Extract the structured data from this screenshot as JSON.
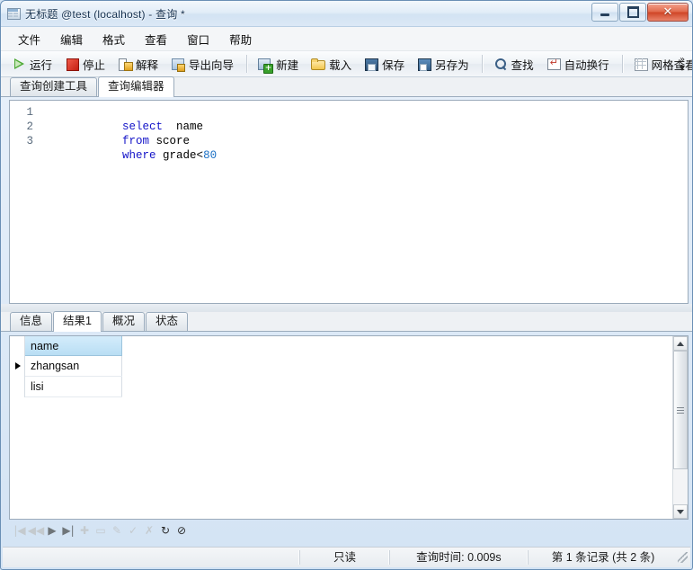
{
  "window": {
    "title": "无标题 @test (localhost) - 查询 *",
    "icon": "query-window-icon",
    "buttons": {
      "minimize": "minimize-icon",
      "maximize": "maximize-icon",
      "close": "✕"
    }
  },
  "menubar": {
    "items": [
      {
        "label": "文件"
      },
      {
        "label": "编辑"
      },
      {
        "label": "格式"
      },
      {
        "label": "查看"
      },
      {
        "label": "窗口"
      },
      {
        "label": "帮助"
      }
    ]
  },
  "toolbar": {
    "groups": [
      {
        "items": [
          {
            "label": "运行",
            "icon": "run-icon"
          },
          {
            "label": "停止",
            "icon": "stop-icon"
          },
          {
            "label": "解释",
            "icon": "explain-icon"
          },
          {
            "label": "导出向导",
            "icon": "export-wizard-icon"
          }
        ]
      },
      {
        "items": [
          {
            "label": "新建",
            "icon": "new-icon"
          },
          {
            "label": "载入",
            "icon": "load-icon"
          },
          {
            "label": "保存",
            "icon": "save-icon"
          },
          {
            "label": "另存为",
            "icon": "save-as-icon"
          }
        ]
      },
      {
        "items": [
          {
            "label": "查找",
            "icon": "find-icon"
          },
          {
            "label": "自动换行",
            "icon": "word-wrap-icon"
          }
        ]
      },
      {
        "items": [
          {
            "label": "网格查看",
            "icon": "grid-view-icon"
          }
        ]
      }
    ],
    "overflow": "»"
  },
  "editor_tabs": {
    "items": [
      {
        "label": "查询创建工具",
        "active": false
      },
      {
        "label": "查询编辑器",
        "active": true
      }
    ]
  },
  "editor": {
    "line_numbers": [
      "1",
      "2",
      "3"
    ],
    "lines": [
      {
        "tokens": [
          {
            "t": "select",
            "k": "kw"
          },
          {
            "t": "  ",
            "k": "plain"
          },
          {
            "t": "name",
            "k": "plain"
          }
        ]
      },
      {
        "tokens": [
          {
            "t": "from",
            "k": "kw"
          },
          {
            "t": " ",
            "k": "plain"
          },
          {
            "t": "score",
            "k": "plain"
          }
        ]
      },
      {
        "tokens": [
          {
            "t": "where",
            "k": "kw"
          },
          {
            "t": " ",
            "k": "plain"
          },
          {
            "t": "grade<",
            "k": "plain"
          },
          {
            "t": "80",
            "k": "num"
          }
        ]
      }
    ],
    "plain_text": "select  name\nfrom score\nwhere grade<80",
    "colors": {
      "keyword": "#1313c8",
      "number": "#1a6fc4",
      "identifier": "#000000",
      "linenumber": "#5a6b7d"
    }
  },
  "result_tabs": {
    "items": [
      {
        "label": "信息",
        "active": false
      },
      {
        "label": "结果1",
        "active": true
      },
      {
        "label": "概况",
        "active": false
      },
      {
        "label": "状态",
        "active": false
      }
    ]
  },
  "grid": {
    "columns": [
      "name"
    ],
    "rows": [
      {
        "current": true,
        "cells": [
          "zhangsan"
        ]
      },
      {
        "current": false,
        "cells": [
          "lisi"
        ]
      }
    ],
    "header_color": "#b9def4",
    "current_row_marker": "▶"
  },
  "grid_scrollbar": {
    "up_arrow": "scroll-up-icon",
    "down_arrow": "scroll-down-icon",
    "thumb": "scroll-thumb"
  },
  "nav_toolbar": {
    "buttons": [
      {
        "name": "first-record-button",
        "glyph": "|◀",
        "state": "disabled"
      },
      {
        "name": "previous-record-button",
        "glyph": "◀◀",
        "state": "disabled"
      },
      {
        "name": "next-record-button",
        "glyph": "▶",
        "state": "enabled-mid"
      },
      {
        "name": "last-record-button",
        "glyph": "▶|",
        "state": "enabled-mid"
      },
      {
        "name": "add-record-button",
        "glyph": "✚",
        "state": "disabled"
      },
      {
        "name": "delete-record-button",
        "glyph": "▭",
        "state": "disabled"
      },
      {
        "name": "edit-record-button",
        "glyph": "✎",
        "state": "disabled"
      },
      {
        "name": "apply-changes-button",
        "glyph": "✓",
        "state": "disabled"
      },
      {
        "name": "cancel-changes-button",
        "glyph": "✗",
        "state": "disabled"
      },
      {
        "name": "refresh-button",
        "glyph": "↻",
        "state": "enabled"
      },
      {
        "name": "stop-button",
        "glyph": "⊘",
        "state": "enabled"
      }
    ]
  },
  "statusbar": {
    "readonly": "只读",
    "query_time": "查询时间: 0.009s",
    "record_info": "第 1 条记录 (共 2 条)"
  }
}
